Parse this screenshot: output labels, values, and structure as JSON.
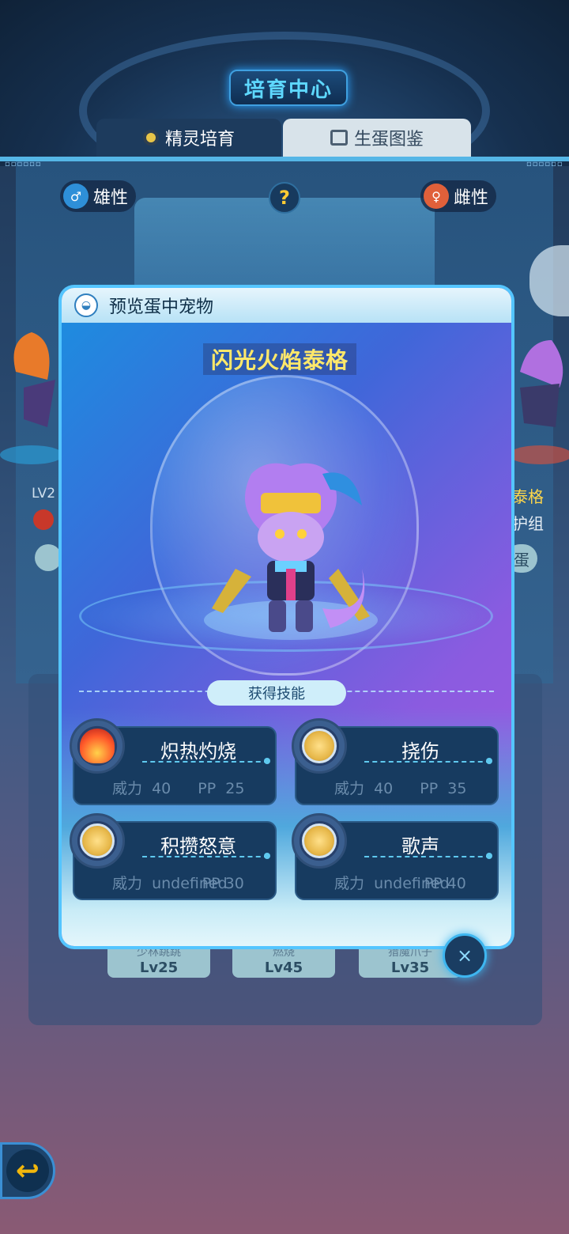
{
  "header": {
    "title": "培育中心"
  },
  "tabs": [
    {
      "label": "精灵培育",
      "active": true,
      "icon": "hexagon-icon"
    },
    {
      "label": "生蛋图鉴",
      "active": false,
      "icon": "book-icon"
    }
  ],
  "genders": {
    "male": "雄性",
    "female": "雌性"
  },
  "help": "?",
  "left_partial": {
    "level": "LV2"
  },
  "right_partial": {
    "name": "泰格",
    "group": "护组",
    "button": "蛋"
  },
  "lower_buttons": [
    {
      "name": "少林跳跳",
      "level": "Lv25"
    },
    {
      "name": "燃烧",
      "level": "Lv45"
    },
    {
      "name": "猎魔爪子",
      "level": "Lv35"
    }
  ],
  "modal": {
    "title": "预览蛋中宠物",
    "pet_name": "闪光火焰泰格",
    "skills_header": "获得技能",
    "skills": [
      {
        "name": "炽热灼烧",
        "power_label": "威力",
        "power": "40",
        "pp_label": "PP",
        "pp": "25",
        "icon": "fire-skill-icon"
      },
      {
        "name": "挠伤",
        "power_label": "威力",
        "power": "40",
        "pp_label": "PP",
        "pp": "35",
        "icon": "normal-skill-icon"
      },
      {
        "name": "积攒怒意",
        "power_label": "威力",
        "power": "undefined",
        "pp_label": "PP",
        "pp": "30",
        "icon": "normal-skill-icon"
      },
      {
        "name": "歌声",
        "power_label": "威力",
        "power": "undefined",
        "pp_label": "PP",
        "pp": "40",
        "icon": "normal-skill-icon"
      }
    ],
    "close_label": "×"
  },
  "colors": {
    "accent": "#54c5ff",
    "name_yellow": "#ffe86a",
    "card_bg": "#173b60"
  }
}
